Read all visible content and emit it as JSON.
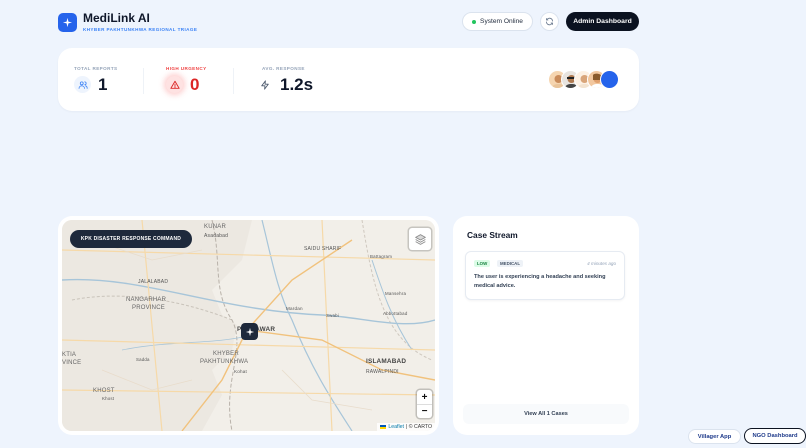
{
  "header": {
    "title": "MediLink AI",
    "subtitle": "KHYBER PAKHTUNKHWA REGIONAL TRIAGE",
    "status": "System Online",
    "admin_button": "Admin Dashboard",
    "logo_icon": "sparkle-icon",
    "refresh_icon": "refresh-icon"
  },
  "stats": {
    "total_reports": {
      "label": "TOTAL REPORTS",
      "value": "1",
      "icon": "users-icon"
    },
    "high_urgency": {
      "label": "HIGH URGENCY",
      "value": "0",
      "icon": "alert-triangle-icon"
    },
    "avg_response": {
      "label": "AVG. RESPONSE",
      "value": "1.2s",
      "icon": "bolt-icon"
    }
  },
  "map": {
    "badge": "KPK DISASTER RESPONSE COMMAND",
    "zoom_in": "+",
    "zoom_out": "−",
    "attribution_leaflet": "Leaflet",
    "attribution_rest": "| © CARTO",
    "labels": {
      "kunar": "KUNAR",
      "asadabad": "Asadabad",
      "saidu_sharif": "SAIDU SHARIF",
      "battagram": "Battagram",
      "jalalabad": "JALALABAD",
      "nangarhar": "NANGARHAR",
      "province": "PROVINCE",
      "mansehra": "Mansehra",
      "mardan": "Mardan",
      "swabi": "Swabi",
      "abbottabad": "Abbottabad",
      "peshawar": "PESHAWAR",
      "paktia": "KTIA",
      "vince": "VINCE",
      "sadda": "Sadda",
      "khyber": "KHYBER",
      "pakhtunkhwa": "PAKHTUNKHWA",
      "kohat": "Kohat",
      "islamabad": "ISLAMABAD",
      "rawalpindi": "RAWALPINDI",
      "khost": "KHOST",
      "khost_town": "Khost"
    }
  },
  "case_stream": {
    "title": "Case Stream",
    "cases": [
      {
        "urgency": "LOW",
        "category": "MEDICAL",
        "time": "4 minutes ago",
        "text": "The user is experiencing a headache and seeking medical advice."
      }
    ],
    "view_all": "View All 1 Cases"
  },
  "footer": {
    "villager_app": "Villager App",
    "ngo_dashboard": "NGO Dashboard"
  },
  "colors": {
    "accent": "#2563eb",
    "dark": "#0b1220",
    "danger": "#dc2626",
    "success": "#22c55e",
    "background": "#eef4fd"
  }
}
